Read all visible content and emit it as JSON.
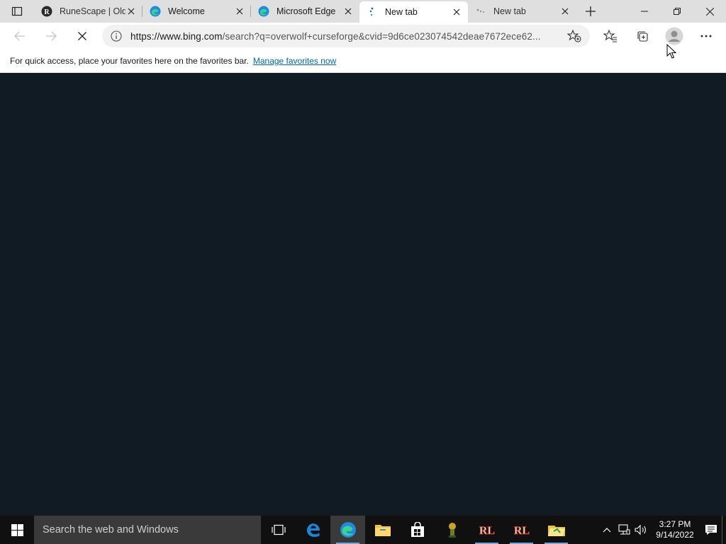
{
  "browser": {
    "tabs": [
      {
        "title": "RuneScape | Old School",
        "icon": "runescape-icon"
      },
      {
        "title": "Welcome",
        "icon": "edge-icon"
      },
      {
        "title": "Microsoft Edge",
        "icon": "edge-icon"
      },
      {
        "title": "New tab",
        "icon": "loading-icon",
        "active": true
      },
      {
        "title": "New tab",
        "icon": "loading-icon"
      }
    ],
    "address_bar": {
      "url_host": "https://www.bing.com",
      "url_rest": "/search?q=overwolf+curseforge&cvid=9d6ce023074542deae7672ece62..."
    },
    "favorites_bar": {
      "message": "For quick access, place your favorites here on the favorites bar.",
      "link": "Manage favorites now"
    }
  },
  "taskbar": {
    "search_placeholder": "Search the web and Windows",
    "apps": [
      "task-view-icon",
      "edge-legacy-icon",
      "edge-icon",
      "file-explorer-icon",
      "store-icon",
      "runescape-launcher-icon",
      "runelite-icon",
      "runelite-icon",
      "folder-icon"
    ],
    "clock": {
      "time": "3:27 PM",
      "date": "9/14/2022"
    }
  },
  "colors": {
    "content_bg": "#111b24",
    "tabstrip_bg": "#dfdfdf",
    "link": "#0066b4",
    "taskbar_bg": "#101010"
  }
}
